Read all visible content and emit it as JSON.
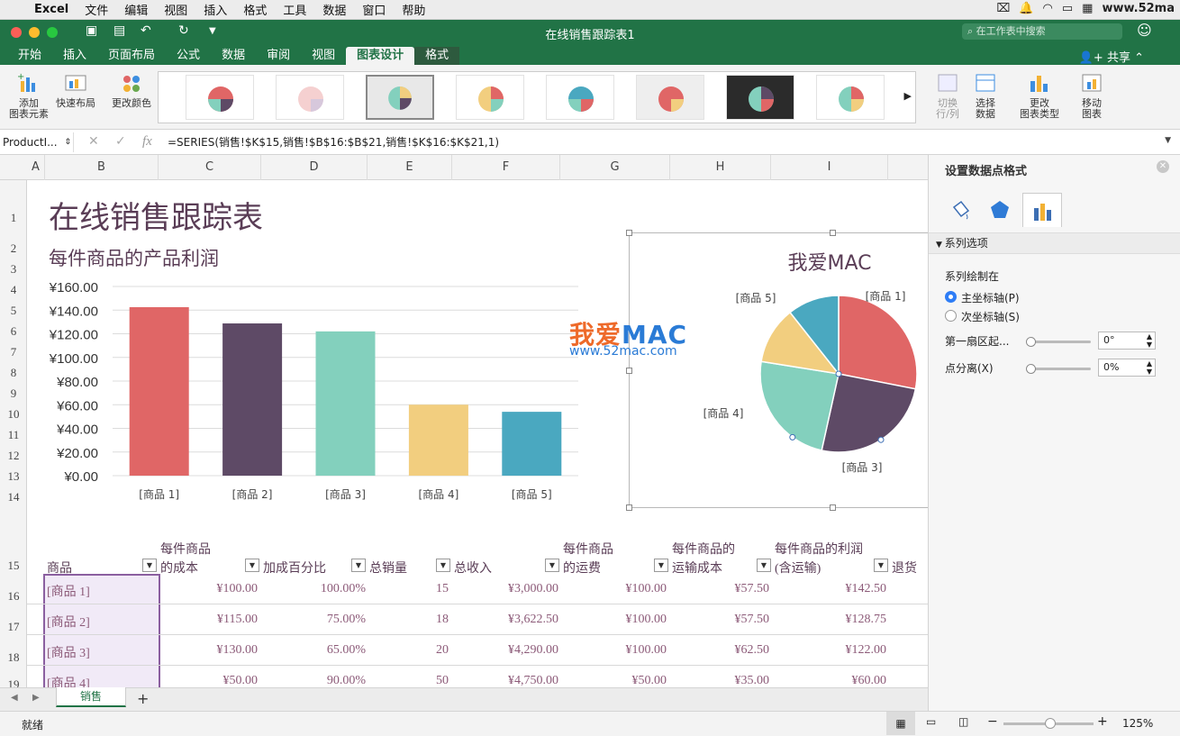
{
  "menubar": {
    "app_name": "Excel",
    "items": [
      "文件",
      "编辑",
      "视图",
      "插入",
      "格式",
      "工具",
      "数据",
      "窗口",
      "帮助"
    ],
    "right_text": "www.52ma"
  },
  "window": {
    "title": "在线销售跟踪表1",
    "search_placeholder": "在工作表中搜索",
    "share_label": "共享"
  },
  "ribbon_tabs": [
    "开始",
    "插入",
    "页面布局",
    "公式",
    "数据",
    "审阅",
    "视图",
    "图表设计",
    "格式"
  ],
  "ribbon": {
    "add_element": "添加\n图表元素",
    "quick_layout": "快速布局",
    "change_colors": "更改颜色",
    "switch_rowcol": "切换\n行/列",
    "select_data": "选择\n数据",
    "change_type": "更改\n图表类型",
    "move_chart": "移动\n图表"
  },
  "formula_bar": {
    "name_box": "ProductI...",
    "fx": "fx",
    "formula": "=SERIES(销售!$K$15,销售!$B$16:$B$21,销售!$K$16:$K$21,1)"
  },
  "columns": [
    "A",
    "B",
    "C",
    "D",
    "E",
    "F",
    "G",
    "H",
    "I"
  ],
  "rows": [
    "1",
    "2",
    "3",
    "4",
    "5",
    "6",
    "7",
    "8",
    "9",
    "10",
    "11",
    "12",
    "13",
    "14",
    "15",
    "16",
    "17",
    "18",
    "19"
  ],
  "sheet": {
    "title": "在线销售跟踪表",
    "watermark_brand": "我爱",
    "watermark_mac": "MAC",
    "watermark_url": "www.52mac.com"
  },
  "chart_data": [
    {
      "type": "bar",
      "title": "每件商品的产品利润",
      "categories": [
        "[商品 1]",
        "[商品 2]",
        "[商品 3]",
        "[商品 4]",
        "[商品 5]"
      ],
      "values": [
        142.5,
        128.75,
        122.0,
        60.0,
        54.0
      ],
      "y_ticks": [
        "¥0.00",
        "¥20.00",
        "¥40.00",
        "¥60.00",
        "¥80.00",
        "¥100.00",
        "¥120.00",
        "¥140.00",
        "¥160.00"
      ],
      "ylim": [
        0,
        160
      ],
      "grid": true,
      "colors": [
        "#e06666",
        "#5e4a66",
        "#83d0bd",
        "#f2ce7f",
        "#4aa8c0"
      ]
    },
    {
      "type": "pie",
      "title": "我爱MAC",
      "labels": [
        "[商品 1]",
        "[商品 2]",
        "[商品 3]",
        "[商品 4]",
        "[商品 5]"
      ],
      "values": [
        142.5,
        128.75,
        122.0,
        60.0,
        54.0
      ],
      "colors": [
        "#e06666",
        "#5e4a66",
        "#83d0bd",
        "#f2ce7f",
        "#4aa8c0"
      ]
    }
  ],
  "table": {
    "headers": [
      {
        "l1": "",
        "l2": "商品"
      },
      {
        "l1": "每件商品",
        "l2": "的成本"
      },
      {
        "l1": "",
        "l2": "加成百分比"
      },
      {
        "l1": "",
        "l2": "总销量"
      },
      {
        "l1": "",
        "l2": "总收入"
      },
      {
        "l1": "每件商品",
        "l2": "的运费"
      },
      {
        "l1": "每件商品的",
        "l2": "运输成本"
      },
      {
        "l1": "每件商品的利润",
        "l2": "(含运输)"
      },
      {
        "l1": "",
        "l2": "退货"
      }
    ],
    "rows": [
      [
        "[商品 1]",
        "¥100.00",
        "100.00%",
        "15",
        "¥3,000.00",
        "¥100.00",
        "¥57.50",
        "¥142.50"
      ],
      [
        "[商品 2]",
        "¥115.00",
        "75.00%",
        "18",
        "¥3,622.50",
        "¥100.00",
        "¥57.50",
        "¥128.75"
      ],
      [
        "[商品 3]",
        "¥130.00",
        "65.00%",
        "20",
        "¥4,290.00",
        "¥100.00",
        "¥62.50",
        "¥122.00"
      ],
      [
        "[商品 4]",
        "¥50.00",
        "90.00%",
        "50",
        "¥4,750.00",
        "¥50.00",
        "¥35.00",
        "¥60.00"
      ]
    ]
  },
  "side_panel": {
    "title": "设置数据点格式",
    "section": "系列选项",
    "plot_on": "系列绘制在",
    "primary_axis": "主坐标轴(P)",
    "secondary_axis": "次坐标轴(S)",
    "first_slice_angle_label": "第一扇区起...",
    "first_slice_angle_value": "0°",
    "point_explosion_label": "点分离(X)",
    "point_explosion_value": "0%"
  },
  "sheet_tabs": {
    "active": "销售",
    "add": "+"
  },
  "status": {
    "ready": "就绪",
    "zoom": "125%"
  }
}
